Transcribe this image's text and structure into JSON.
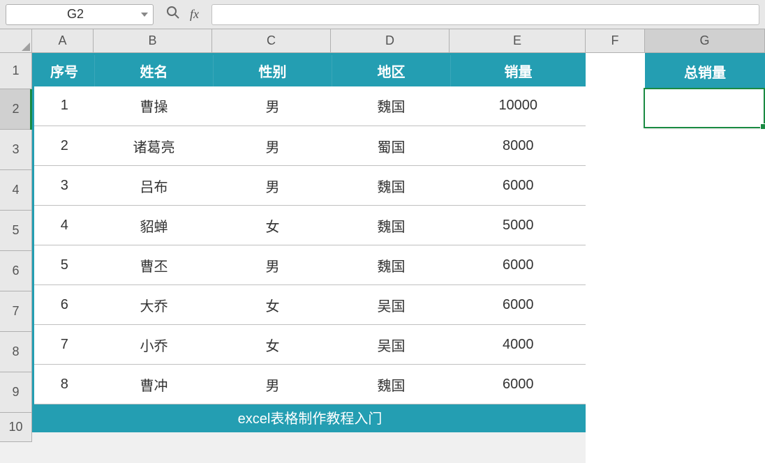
{
  "namebox": {
    "value": "G2"
  },
  "formulabar": {
    "fx_label": "fx",
    "value": ""
  },
  "columns": {
    "a": "A",
    "b": "B",
    "c": "C",
    "d": "D",
    "e": "E",
    "f": "F",
    "g": "G"
  },
  "rows": {
    "r1": "1",
    "r2": "2",
    "r3": "3",
    "r4": "4",
    "r5": "5",
    "r6": "6",
    "r7": "7",
    "r8": "8",
    "r9": "9",
    "r10": "10"
  },
  "table": {
    "headers": {
      "seq": "序号",
      "name": "姓名",
      "gender": "性别",
      "region": "地区",
      "sales": "销量"
    },
    "rows": [
      {
        "seq": "1",
        "name": "曹操",
        "gender": "男",
        "region": "魏国",
        "sales": "10000"
      },
      {
        "seq": "2",
        "name": "诸葛亮",
        "gender": "男",
        "region": "蜀国",
        "sales": "8000"
      },
      {
        "seq": "3",
        "name": "吕布",
        "gender": "男",
        "region": "魏国",
        "sales": "6000"
      },
      {
        "seq": "4",
        "name": "貂蝉",
        "gender": "女",
        "region": "魏国",
        "sales": "5000"
      },
      {
        "seq": "5",
        "name": "曹丕",
        "gender": "男",
        "region": "魏国",
        "sales": "6000"
      },
      {
        "seq": "6",
        "name": "大乔",
        "gender": "女",
        "region": "吴国",
        "sales": "6000"
      },
      {
        "seq": "7",
        "name": "小乔",
        "gender": "女",
        "region": "吴国",
        "sales": "4000"
      },
      {
        "seq": "8",
        "name": "曹冲",
        "gender": "男",
        "region": "魏国",
        "sales": "6000"
      }
    ],
    "footer": "excel表格制作教程入门",
    "total_header": "总销量"
  },
  "selected_cell": {
    "address": "G2",
    "value": ""
  }
}
